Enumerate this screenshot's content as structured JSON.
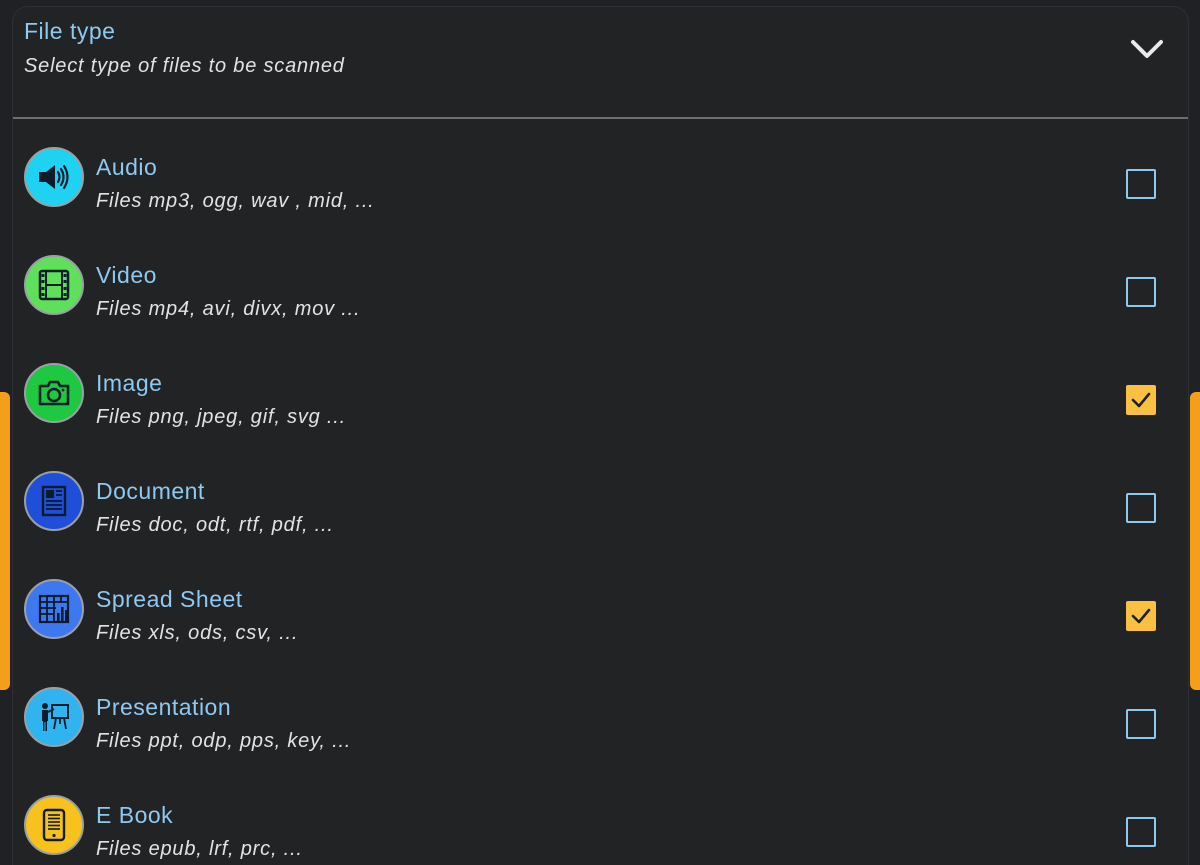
{
  "header": {
    "title": "File type",
    "subtitle": "Select type of files to be scanned",
    "toggle_icon": "chevron-down-icon"
  },
  "file_types": [
    {
      "label": "Audio",
      "description": "Files mp3, ogg, wav , mid, ...",
      "icon": "speaker-icon",
      "icon_color": "#1fd2f2",
      "checked": false
    },
    {
      "label": "Video",
      "description": "Files mp4, avi, divx, mov ...",
      "icon": "film-icon",
      "icon_color": "#5ee05b",
      "checked": false
    },
    {
      "label": "Image",
      "description": "Files png, jpeg, gif, svg ...",
      "icon": "camera-icon",
      "icon_color": "#1ec840",
      "checked": true
    },
    {
      "label": "Document",
      "description": "Files doc, odt, rtf, pdf, ...",
      "icon": "document-icon",
      "icon_color": "#1f4fd8",
      "checked": false
    },
    {
      "label": "Spread Sheet",
      "description": "Files xls, ods, csv, ...",
      "icon": "spreadsheet-icon",
      "icon_color": "#3d78f0",
      "checked": true
    },
    {
      "label": "Presentation",
      "description": "Files ppt, odp, pps, key, ...",
      "icon": "presentation-icon",
      "icon_color": "#2fb4f0",
      "checked": false
    },
    {
      "label": "E Book",
      "description": "Files epub, lrf, prc, ...",
      "icon": "ebook-icon",
      "icon_color": "#f7c21c",
      "checked": false
    }
  ],
  "colors": {
    "background": "#202124",
    "title_text": "#8ec9f2",
    "subtitle_text": "#e2e3e5",
    "checkbox_checked": "#f9c042",
    "edge_handle": "#f59e1a"
  }
}
